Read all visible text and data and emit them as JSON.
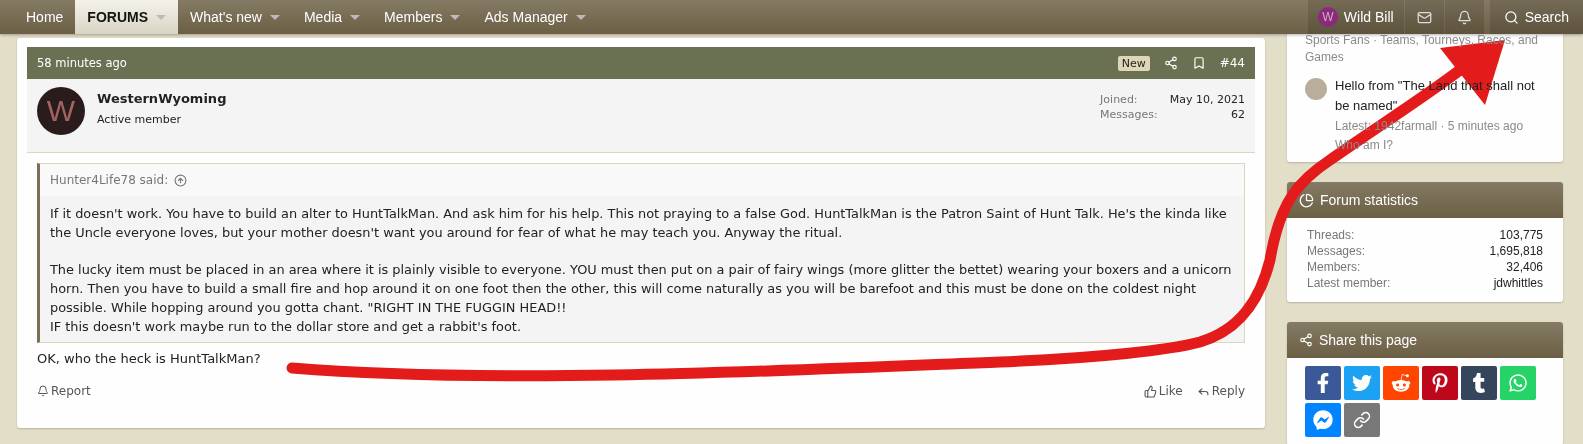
{
  "nav": {
    "items": [
      {
        "label": "Home",
        "selected": false,
        "has_menu": false
      },
      {
        "label": "FORUMS",
        "selected": true,
        "has_menu": true
      },
      {
        "label": "What's new",
        "selected": false,
        "has_menu": true
      },
      {
        "label": "Media",
        "selected": false,
        "has_menu": true
      },
      {
        "label": "Members",
        "selected": false,
        "has_menu": true
      },
      {
        "label": "Ads Manager",
        "selected": false,
        "has_menu": true
      }
    ],
    "user": {
      "initial": "W",
      "name": "Wild Bill"
    },
    "search": "Search"
  },
  "post": {
    "time": "58 minutes ago",
    "badge": "New",
    "number": "#44",
    "author": {
      "initial": "W",
      "name": "WesternWyoming",
      "title": "Active member"
    },
    "stats": [
      {
        "label": "Joined:",
        "value": "May 10, 2021"
      },
      {
        "label": "Messages:",
        "value": "62"
      }
    ],
    "quote": {
      "author": "Hunter4Life78 said:",
      "paragraphs": [
        "If it doesn't work. You have to build an alter to HuntTalkMan. And ask him for his help. This not praying to a false God. HuntTalkMan is the Patron Saint of Hunt Talk. He's the kinda like the Uncle everyone loves, but your mother doesn't want you around for fear of what he may teach you. Anyway the ritual.",
        "The lucky item must be placed in an area where it is plainly visible to everyone. YOU must then put on a pair of fairy wings (more glitter the bettet) wearing your boxers and a unicorn horn. Then you have to build a small fire and hop around it on one foot then the other, this will come naturally as you will be barefoot and this must be done on the coldest night possible. While hopping around you gotta chant. \"RIGHT IN THE FUGGIN HEAD!!\nIF this doesn't work maybe run to the dollar store and get a rabbit's foot."
      ]
    },
    "body": "OK, who the heck is HuntTalkMan?",
    "actions": {
      "report": "Report",
      "like": "Like",
      "reply": "Reply"
    }
  },
  "sidebar": {
    "threads": [
      {
        "forum": "Sports Fans · Teams, Tourneys, Races, and Games"
      },
      {
        "title": "Hello from \"The Land that shall not be named\"",
        "latest": "Latest: 1942farmall · 5 minutes ago",
        "forum": "Who am I?"
      }
    ],
    "stats": {
      "title": "Forum statistics",
      "rows": [
        {
          "label": "Threads:",
          "value": "103,775"
        },
        {
          "label": "Messages:",
          "value": "1,695,818"
        },
        {
          "label": "Members:",
          "value": "32,406"
        },
        {
          "label": "Latest member:",
          "value": "jdwhittles"
        }
      ]
    },
    "share": {
      "title": "Share this page",
      "buttons": [
        {
          "kind": "facebook",
          "color": "#3b5998"
        },
        {
          "kind": "twitter",
          "color": "#1da1f2"
        },
        {
          "kind": "reddit",
          "color": "#ff4500"
        },
        {
          "kind": "pinterest",
          "color": "#bd081c"
        },
        {
          "kind": "tumblr",
          "color": "#35465c"
        },
        {
          "kind": "whatsapp",
          "color": "#25d366"
        },
        {
          "kind": "messenger",
          "color": "#0084ff"
        },
        {
          "kind": "link",
          "color": "#787878"
        }
      ]
    }
  }
}
